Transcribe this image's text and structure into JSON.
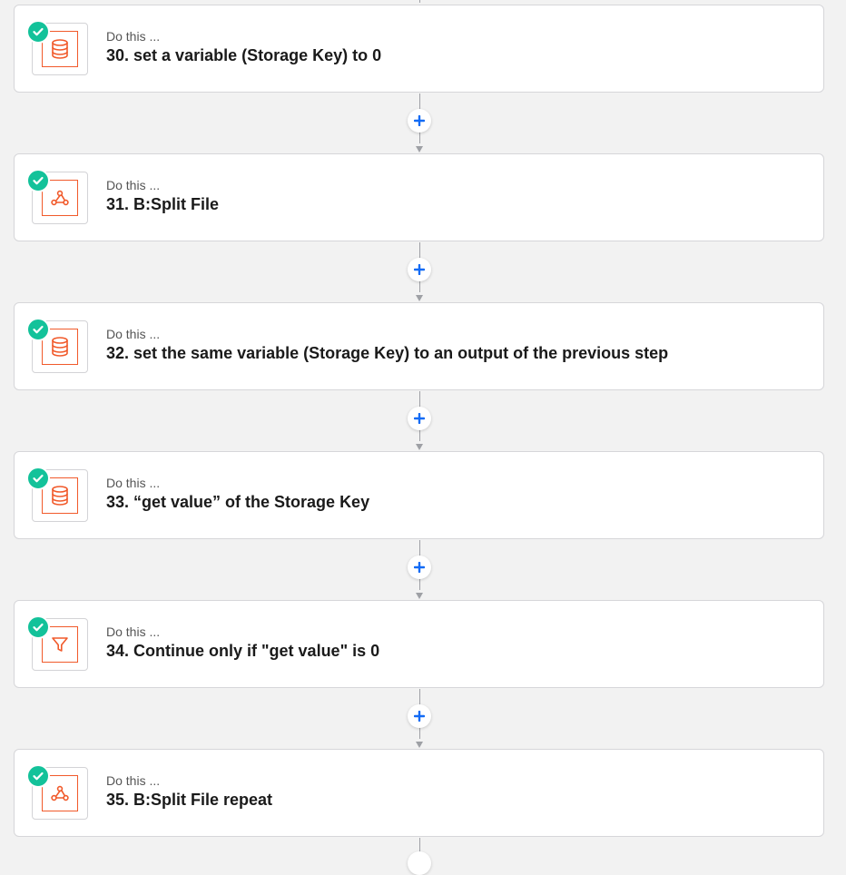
{
  "colors": {
    "accent": "#136bf5",
    "success": "#13c29a",
    "app_orange": "#f15a2b",
    "background": "#f2f2f2"
  },
  "add_step_icon": "plus-icon",
  "steps": [
    {
      "prefix": "Do this ...",
      "title": "30. set a variable (Storage Key) to 0",
      "icon": "storage-icon",
      "status": "check-icon"
    },
    {
      "prefix": "Do this ...",
      "title": "31. B:Split File",
      "icon": "webhook-icon",
      "status": "check-icon"
    },
    {
      "prefix": "Do this ...",
      "title": "32. set the same variable (Storage Key) to an output of the previous step",
      "icon": "storage-icon",
      "status": "check-icon"
    },
    {
      "prefix": "Do this ...",
      "title": "33. “get value” of the Storage Key",
      "icon": "storage-icon",
      "status": "check-icon"
    },
    {
      "prefix": "Do this ...",
      "title": "34. Continue only if \"get value\" is 0",
      "icon": "filter-icon",
      "status": "check-icon"
    },
    {
      "prefix": "Do this ...",
      "title": "35. B:Split File repeat",
      "icon": "webhook-icon",
      "status": "check-icon"
    }
  ]
}
